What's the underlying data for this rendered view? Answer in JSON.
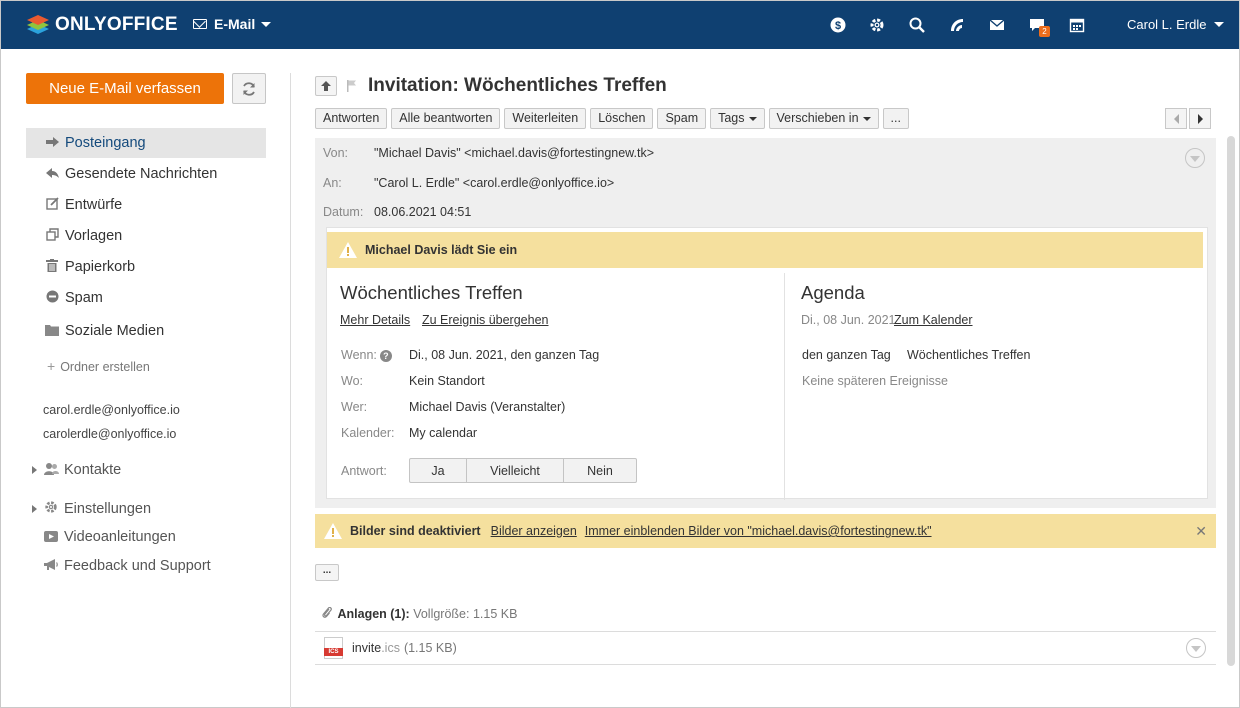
{
  "header": {
    "logo_text": "ONLYOFFICE",
    "module": "E-Mail",
    "user_name": "Carol L. Erdle",
    "chat_badge": "2"
  },
  "sidebar": {
    "compose_label": "Neue E-Mail verfassen",
    "folders": [
      {
        "label": "Posteingang",
        "icon": "arrow-right-icon"
      },
      {
        "label": "Gesendete Nachrichten",
        "icon": "reply-icon"
      },
      {
        "label": "Entwürfe",
        "icon": "edit-icon"
      },
      {
        "label": "Vorlagen",
        "icon": "copy-icon"
      },
      {
        "label": "Papierkorb",
        "icon": "trash-icon"
      },
      {
        "label": "Spam",
        "icon": "block-icon"
      },
      {
        "label": "Soziale Medien",
        "icon": "folder-icon"
      }
    ],
    "create_folder": "Ordner erstellen",
    "accounts": [
      "carol.erdle@onlyoffice.io",
      "carolerdle@onlyoffice.io"
    ],
    "contacts": "Kontakte",
    "settings": "Einstellungen",
    "video": "Videoanleitungen",
    "feedback": "Feedback und Support"
  },
  "message": {
    "title": "Invitation: Wöchentliches Treffen",
    "toolbar": [
      "Antworten",
      "Alle beantworten",
      "Weiterleiten",
      "Löschen",
      "Spam",
      "Tags",
      "Verschieben in",
      "..."
    ],
    "from_label": "Von:",
    "from_value": "\"Michael Davis\" <michael.davis@fortestingnew.tk>",
    "to_label": "An:",
    "to_value": "\"Carol L. Erdle\" <carol.erdle@onlyoffice.io>",
    "date_label": "Datum:",
    "date_value": "08.06.2021  04:51"
  },
  "invite": {
    "banner": "Michael Davis lädt Sie ein",
    "title": "Wöchentliches Treffen",
    "link_details": "Mehr Details",
    "link_transfer": "Zu Ereignis übergehen",
    "when_label": "Wenn:",
    "when_value": "Di., 08 Jun. 2021, den ganzen Tag",
    "where_label": "Wo:",
    "where_value": "Kein Standort",
    "who_label": "Wer:",
    "who_value": "Michael Davis  (Veranstalter)",
    "calendar_label": "Kalender:",
    "calendar_value": "My calendar",
    "answer_label": "Antwort:",
    "answers": [
      "Ja",
      "Vielleicht",
      "Nein"
    ],
    "agenda_title": "Agenda",
    "agenda_date": "Di., 08 Jun. 2021",
    "agenda_link": "Zum Kalender",
    "agenda_time": "den ganzen Tag",
    "agenda_event": "Wöchentliches Treffen",
    "agenda_none": "Keine späteren Ereignisse"
  },
  "images_banner": {
    "title": "Bilder sind deaktiviert",
    "show": "Bilder anzeigen",
    "always": "Immer einblenden Bilder von \"michael.davis@fortestingnew.tk\""
  },
  "attachments": {
    "more": "...",
    "title": "Anlagen (1):",
    "total": "Vollgröße: 1.15 KB",
    "file_name": "invite",
    "file_ext": ".ics",
    "file_size": "(1.15 KB)",
    "icon_text": "ICS"
  }
}
